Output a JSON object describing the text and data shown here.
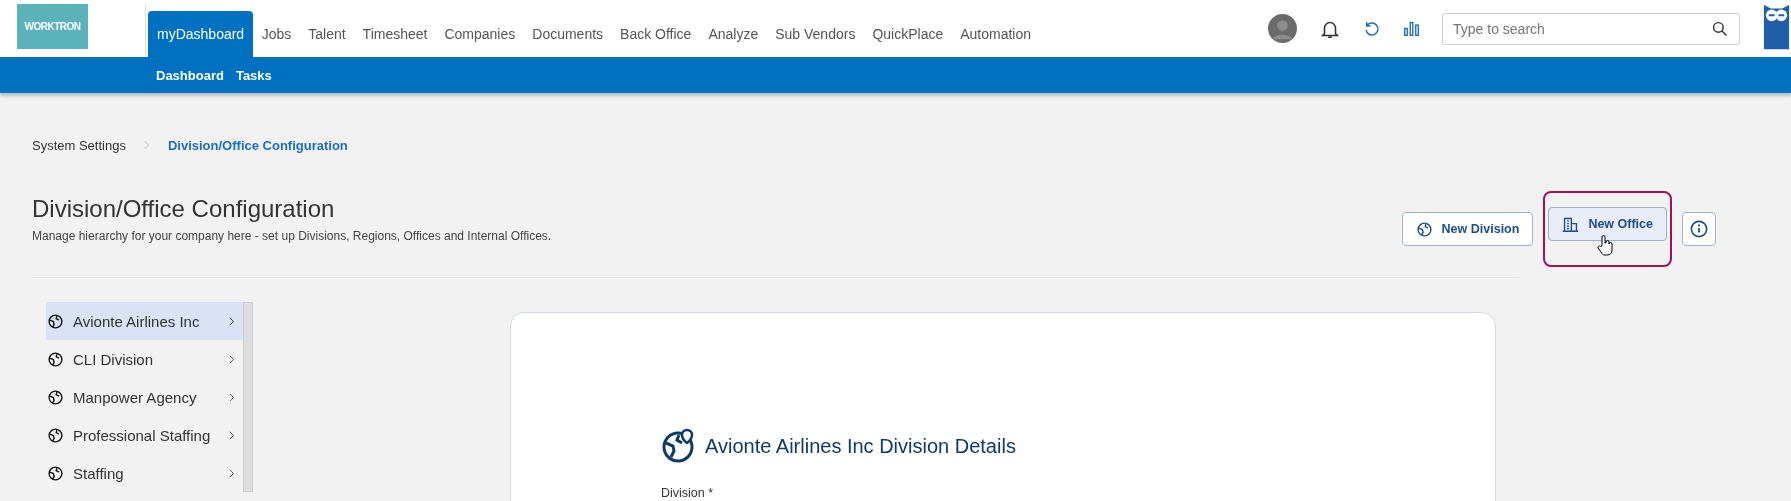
{
  "logo": {
    "text": "WORKTRON"
  },
  "nav": [
    {
      "label": "myDashboard",
      "selected": true
    },
    {
      "label": "Jobs",
      "selected": false
    },
    {
      "label": "Talent",
      "selected": false
    },
    {
      "label": "Timesheet",
      "selected": false
    },
    {
      "label": "Companies",
      "selected": false
    },
    {
      "label": "Documents",
      "selected": false
    },
    {
      "label": "Back Office",
      "selected": false
    },
    {
      "label": "Analyze",
      "selected": false
    },
    {
      "label": "Sub Vendors",
      "selected": false
    },
    {
      "label": "QuickPlace",
      "selected": false
    },
    {
      "label": "Automation",
      "selected": false
    }
  ],
  "search": {
    "placeholder": "Type to search"
  },
  "subnav": [
    "Dashboard",
    "Tasks"
  ],
  "breadcrumb": [
    {
      "label": "System Settings",
      "current": false
    },
    {
      "label": "Division/Office Configuration",
      "current": true
    }
  ],
  "page": {
    "title": "Division/Office Configuration",
    "subtitle": "Manage hierarchy for your company here - set up Divisions, Regions, Offices and Internal Offices."
  },
  "actions": [
    {
      "kind": "division",
      "label": "New Division",
      "hovered": false
    },
    {
      "kind": "office",
      "label": "New Office",
      "hovered": true
    },
    {
      "kind": "info",
      "hovered": false
    }
  ],
  "sidebar": [
    {
      "label": "Avionte Airlines Inc",
      "selected": true
    },
    {
      "label": "CLI Division",
      "selected": false
    },
    {
      "label": "Manpower Agency",
      "selected": false
    },
    {
      "label": "Professional Staffing",
      "selected": false
    },
    {
      "label": "Staffing",
      "selected": false
    }
  ],
  "details": {
    "title": "Avionte Airlines Inc Division Details",
    "field_label": "Division *"
  }
}
